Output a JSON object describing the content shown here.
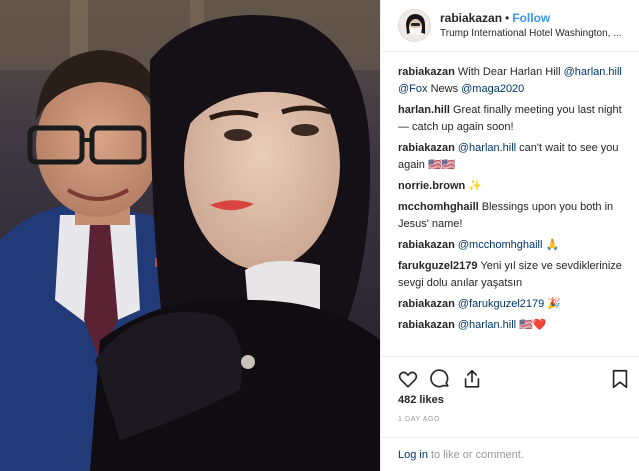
{
  "header": {
    "username": "rabiakazan",
    "separator": "•",
    "follow_label": "Follow",
    "location": "Trump International Hotel Washington, ..."
  },
  "comments": [
    {
      "user": "rabiakazan",
      "parts": [
        "With Dear Harlan Hill ",
        "@harlan.hill",
        " ",
        "@Fox",
        " News ",
        "@maga2020"
      ]
    },
    {
      "user": "harlan.hill",
      "parts": [
        "Great finally meeting you last night — catch up again soon!"
      ]
    },
    {
      "user": "rabiakazan",
      "parts": [
        "@harlan.hill",
        " can't wait to see you again 🇺🇸🇺🇸"
      ]
    },
    {
      "user": "norrie.brown",
      "parts": [
        "✨"
      ]
    },
    {
      "user": "mcchomhghaill",
      "parts": [
        "Blessings upon you both in Jesus' name!"
      ]
    },
    {
      "user": "rabiakazan",
      "parts": [
        "@mcchomhghaill",
        " 🙏"
      ]
    },
    {
      "user": "farukguzel2179",
      "parts": [
        "Yeni yıl size ve sevdiklerinize sevgi dolu anılar yaşatsın"
      ]
    },
    {
      "user": "rabiakazan",
      "parts": [
        "@farukguzel2179",
        " 🎉"
      ]
    },
    {
      "user": "rabiakazan",
      "parts": [
        "@harlan.hill",
        " 🇺🇸❤️"
      ]
    }
  ],
  "actions": {
    "like_icon": "heart-icon",
    "comment_icon": "comment-bubble-icon",
    "share_icon": "share-icon",
    "save_icon": "bookmark-icon"
  },
  "likes": {
    "count": "482",
    "label": "likes"
  },
  "timestamp": "1 DAY AGO",
  "login": {
    "link": "Log in",
    "rest": "to like or comment."
  },
  "colors": {
    "link": "#003569",
    "follow": "#3897f0",
    "muted": "#999999",
    "border": "#efefef"
  }
}
